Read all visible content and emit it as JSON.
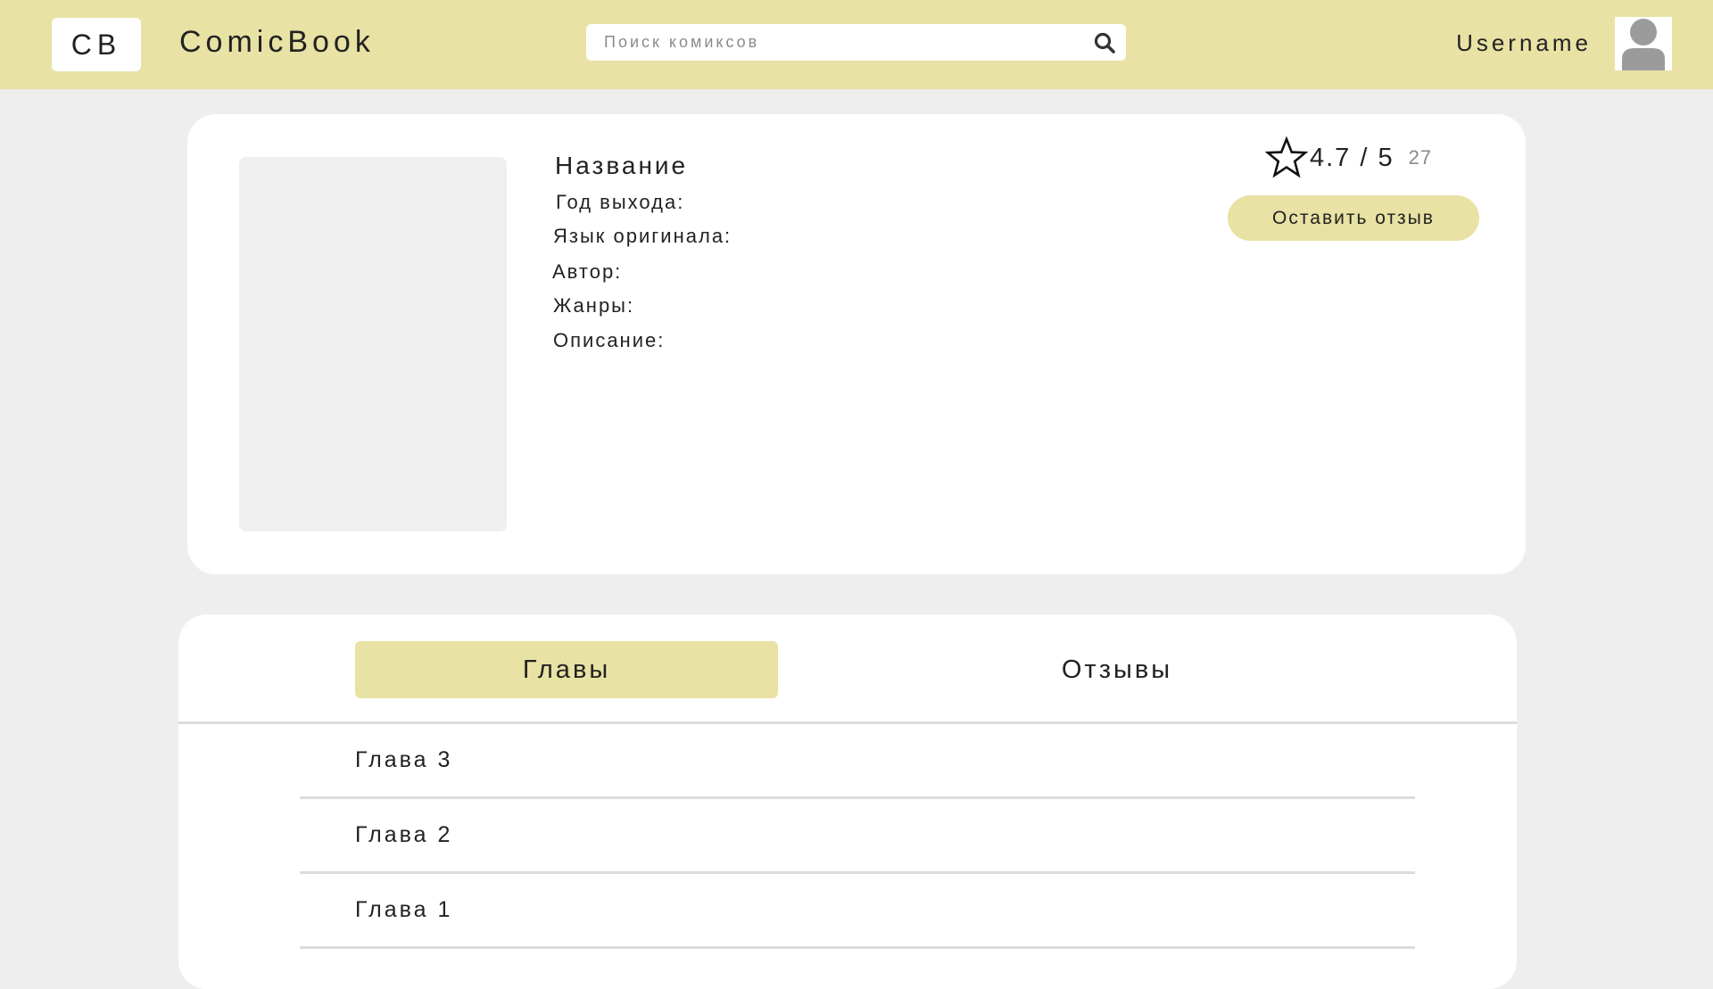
{
  "header": {
    "logo_text": "CB",
    "brand": "ComicBook",
    "search_placeholder": "Поиск комиксов",
    "username": "Username",
    "accent_color": "#e8e2a4"
  },
  "comic": {
    "title": "Название",
    "fields": {
      "year": "Год выхода:",
      "language": "Язык оригинала:",
      "author": "Автор:",
      "genres": "Жанры:",
      "description": "Описание:"
    },
    "rating": "4.7 / 5",
    "rating_count": "27",
    "review_button": "Оставить отзыв"
  },
  "tabs": {
    "chapters": "Главы",
    "reviews": "Отзывы",
    "active": "chapters"
  },
  "chapters": [
    "Глава 3",
    "Глава 2",
    "Глава 1"
  ],
  "icons": {
    "search": "search-icon",
    "star": "star-icon",
    "avatar": "user-avatar-icon"
  }
}
